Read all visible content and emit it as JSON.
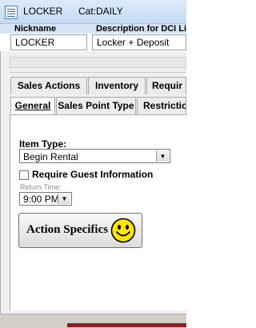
{
  "window": {
    "title": "LOCKER",
    "category": "Cat:DAILY"
  },
  "header": {
    "nickname_label": "Nickname",
    "description_label": "Description for DCI Li",
    "nickname_value": "LOCKER",
    "description_value": "Locker + Deposit"
  },
  "tabs_top": [
    {
      "label": "Sales Actions"
    },
    {
      "label": "Inventory"
    },
    {
      "label": "Requir"
    }
  ],
  "tabs_bottom": [
    {
      "label": "General",
      "active": true
    },
    {
      "label": "Sales Point Type"
    },
    {
      "label": "Restrictio"
    }
  ],
  "general": {
    "item_type_label": "Item Type:",
    "item_type_value": "Begin Rental",
    "require_guest_label": "Require Guest Information",
    "require_guest_checked": false,
    "return_time_label": "Return Time:",
    "return_time_value": "9:00 PM",
    "action_button_label": "Action Specifics",
    "action_icon": "smiley-icon"
  },
  "colors": {
    "titlebar": "#c4daf3",
    "smiley": "#ffe600"
  }
}
